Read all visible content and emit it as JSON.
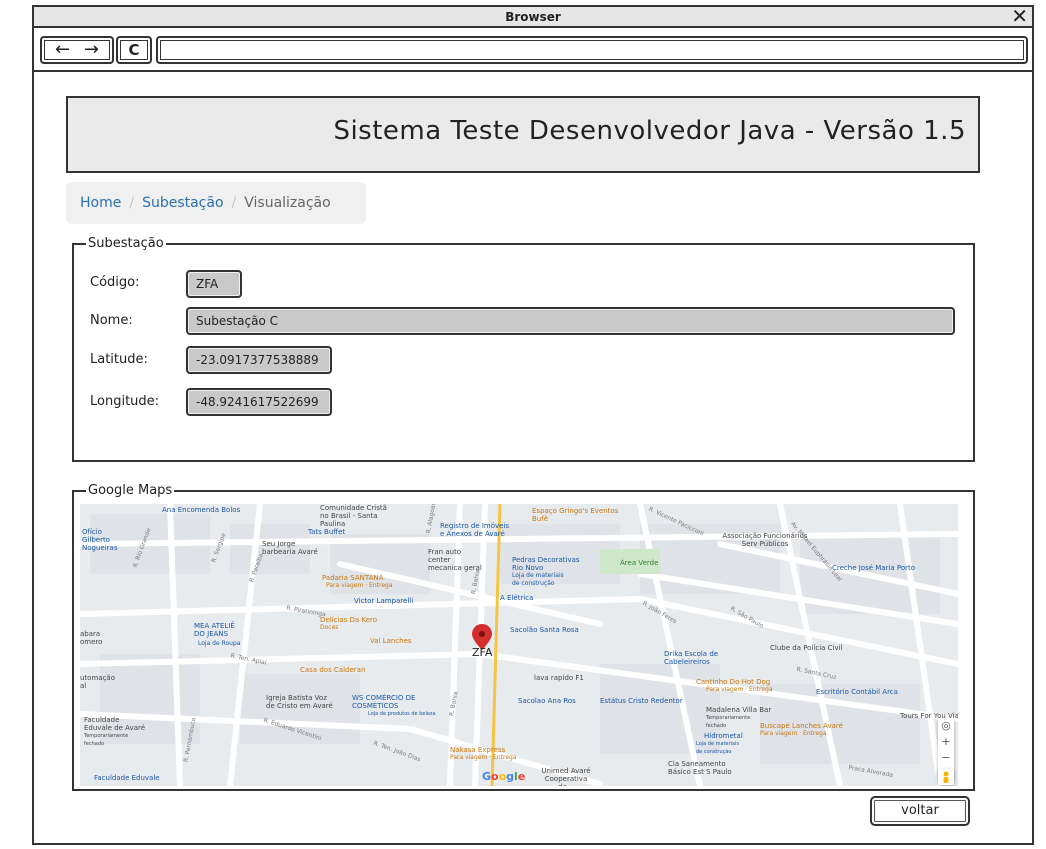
{
  "browser": {
    "title": "Browser",
    "close_glyph": "✕",
    "back_glyph": "←",
    "forward_glyph": "→",
    "reload_glyph": "C",
    "url": ""
  },
  "header": {
    "title": "Sistema Teste Desenvolvedor Java -  Versão 1.5"
  },
  "breadcrumb": {
    "home": "Home",
    "section": "Subestação",
    "current": "Visualização"
  },
  "form": {
    "legend": "Subestação",
    "codigo_label": "Código:",
    "codigo_value": "ZFA",
    "nome_label": "Nome:",
    "nome_value": "Subestação C",
    "latitude_label": "Latitude:",
    "latitude_value": "-23.0917377538889",
    "longitude_label": "Longitude:",
    "longitude_value": "-48.9241617522699"
  },
  "maps": {
    "legend": "Google Maps",
    "marker_label": "ZFA",
    "logo_letters": [
      "G",
      "o",
      "o",
      "g",
      "l",
      "e"
    ],
    "places": {
      "ana_encomenda": "Ana Encomenda Bolos",
      "comunidade": "Comunidade Cristã no Brasil - Santa Paulina",
      "registro_imoveis": "Registro de Imóveis e Anexos de Avaré",
      "espaco_gringos": "Espaço Gringo's Eventos",
      "buffet_sub": "Bufê",
      "associacao": "Associação Funcionários Serv Públicos",
      "oficio_gilberto": "Ofício Gilberto Nogueiras",
      "tats_buffet": "Tats Buffet",
      "seu_jorge": "Seu Jorge barbearia Avaré",
      "fran_auto": "Fran auto center mecanica geral",
      "pedras": "Pedras Decorativas Rio Novo",
      "pedras_sub": "Loja de materiais de construção",
      "area_verde": "Área Verde",
      "creche": "Creche José Maria Porto",
      "padaria": "Padaria SANTANA",
      "padaria_sub": "Para viagem · Entrega",
      "victor": "Victor Lamparelli",
      "a_eletrica": "A Elétrica",
      "delicias": "Delícias Da Kero",
      "delicias_sub": "Doces",
      "mea_atelie": "MEA ATELIÊ DO JEANS",
      "mea_sub": "Loja de Roupa",
      "val_lanches": "Val Lanches",
      "sacolao_santa_rosa": "Sacolão Santa Rosa",
      "clube_policia": "Clube da Polícia Civil",
      "drika": "Drika Escola de Cabeleireiros",
      "casa_calderan": "Casa dos Calderan",
      "lava_rapido": "lava rapido F1",
      "cantinho": "Cantinho Do Hot Dog",
      "cantinho_sub": "Para viagem · Entrega",
      "escritorio": "Escritório Contábil Arca",
      "igreja": "Igreja Batista Voz de Cristo em Avaré",
      "ws_comercio": "WS COMÉRCIO DE COSMÉTICOS",
      "ws_sub": "Loja de produtos de beleza",
      "sacolao_ana": "Sacolao Ana Ros",
      "estatus": "Estátus Cristo Redentor",
      "madalena": "Madalena Villa Bar",
      "madalena_sub": "Temporariamente fechado",
      "buscape": "Buscapé Lanches Avaré",
      "buscape_sub": "Para viagem · Entrega",
      "tours": "Tours For You Via",
      "faculdade_eduvale": "Faculdade Eduvale de Avaré",
      "faculdade_sub": "Temporariamente fechado",
      "hidrometal": "Hidrometal",
      "hidrometal_sub": "Loja de materiais de construção",
      "nakasa": "Nakasa Express",
      "nakasa_sub": "Para viagem · Entrega",
      "unimed": "Unimed Avaré Cooperativa de...",
      "cia_saneamento": "Cia Saneamento Básico Est S Paulo",
      "faculdade_eduvale_2": "Faculdade Eduvale",
      "abara": "abara omero",
      "automacao": "utomação al",
      "r_bahia": "R. Bahia",
      "r_bahia_2": "R. Bahia",
      "r_piratininga": "R. Piratininga",
      "r_ten_apiai": "R. Ten. Apiaí",
      "r_santa_cruz": "R. Santa Cruz",
      "r_joao_feres": "R. João Feres",
      "r_rio_grande": "R. Rio Grande",
      "r_sergipe": "R. Sergipe",
      "r_sao_paulo": "R. São Paulo",
      "r_pernambuco": "R. Pernambuco",
      "av_misael": "Av. Misael Euphrásio Leal",
      "r_eduardo": "R. Eduardo Vicentini",
      "r_vicente": "R. Vicente Pacicconi",
      "praca_alvorada": "Praca Alvorada",
      "r_alagoas": "R. Alagoas",
      "r_paraiba": "R. Paraíba",
      "r_ten_joao_dias": "R. Ten. João Dias"
    },
    "controls": {
      "zoom_in": "+",
      "zoom_out": "−",
      "locate_glyph": "◎"
    }
  },
  "actions": {
    "back_button": "voltar"
  }
}
